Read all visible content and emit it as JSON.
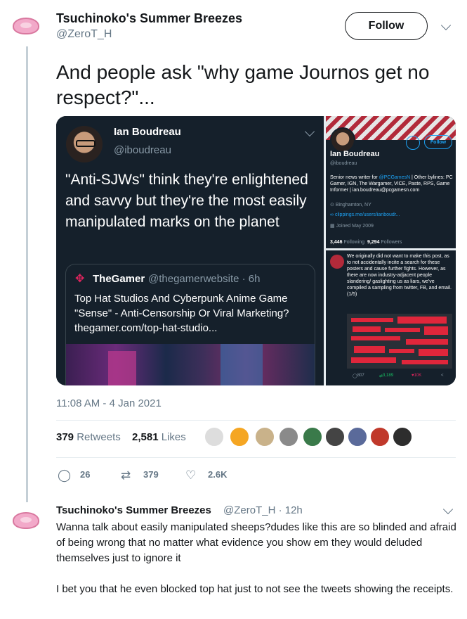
{
  "main_tweet": {
    "author_name": "Tsuchinoko's Summer Breezes",
    "author_handle": "@ZeroT_H",
    "follow_label": "Follow",
    "text": "And people ask \"why game Journos get no respect?\"...",
    "timestamp": "11:08 AM - 4 Jan 2021",
    "retweets_count": "379",
    "retweets_label": "Retweets",
    "likes_count": "2,581",
    "likes_label": "Likes",
    "actions": {
      "reply_count": "26",
      "retweet_count": "379",
      "like_count": "2.6K"
    }
  },
  "embedded": {
    "ian_tweet": {
      "name": "Ian Boudreau",
      "handle": "@iboudreau",
      "text": "\"Anti-SJWs\" think they're enlightened and savvy but they're the most easily manipulated marks on the planet"
    },
    "quote": {
      "source_name": "TheGamer",
      "source_meta": "@thegamerwebsite · 6h",
      "headline": "Top Hat Studios And Cyberpunk Anime Game \"Sense\" - Anti-Censorship Or Viral Marketing?",
      "link": "thegamer.com/top-hat-studio..."
    },
    "profile": {
      "follow_label": "Follow",
      "name": "Ian Boudreau",
      "handle": "@iboudreau",
      "bio_prefix": "Senior news writer for ",
      "bio_link": "@PCGamesN",
      "bio_rest": " | Other bylines: PC Gamer, IGN, The Wargamer, VICE, Paste, RPS, Game Informer | ian.boudreau@pcgamesn.com",
      "location": "Binghamton, NY",
      "website": "clippings.me/users/ianboudr...",
      "joined": "Joined May 2009",
      "following_count": "3,446",
      "following_label": "Following",
      "followers_count": "9,294",
      "followers_label": "Followers"
    },
    "callout": {
      "text": "We originally did not want to make this post, as to not accidentally incite a search for these posters and cause further fights. However, as there are now industry-adjacent people slandering/ gaslighting us as liars, we've compiled a sampling from twitter, FB, and email. (1/5)",
      "replies": "807",
      "retweets": "3,189",
      "likes": "10K"
    }
  },
  "reply": {
    "author_name": "Tsuchinoko's Summer Breezes",
    "meta": "@ZeroT_H · 12h",
    "paragraph_1": "Wanna talk about easily manipulated sheeps?dudes like this are so blinded and afraid of being wrong that no matter what evidence you show em they would deluded themselves just to ignore it",
    "paragraph_2": "I bet you that he even blocked top hat just to not see the tweets showing the receipts."
  },
  "colors": {
    "text_primary": "#14171a",
    "text_secondary": "#657786",
    "dark_bg": "#15202b",
    "link_blue": "#1da1f2"
  }
}
